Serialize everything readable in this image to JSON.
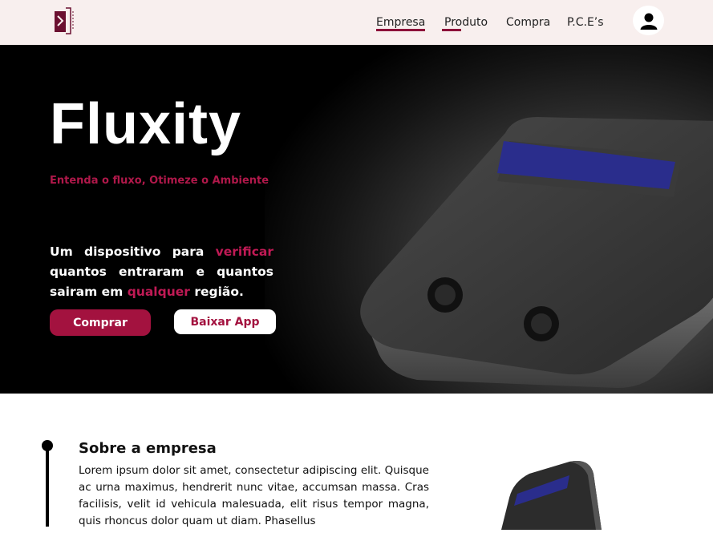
{
  "nav": {
    "links": [
      "Empresa",
      "Produto",
      "Compra",
      "P.C.E’s"
    ]
  },
  "hero": {
    "title": "Fluxity",
    "tagline": "Entenda o fluxo, Otimeze o Ambiente",
    "desc_1": "Um dispositivo para ",
    "desc_hl_1": "verificar",
    "desc_2": " quantos entraram e quantos sairam em ",
    "desc_hl_2": "qualquer",
    "desc_3": " região.",
    "buy_label": "Comprar",
    "app_label": "Baixar App"
  },
  "about": {
    "title": "Sobre a empresa",
    "text": "Lorem ipsum dolor sit amet, consectetur adipiscing elit. Quisque ac urna maximus, hendrerit nunc vitae, accumsan massa. Cras facilisis, velit id vehicula malesuada, elit risus tempor magna, quis rhoncus dolor quam ut diam. Phasellus"
  },
  "colors": {
    "accent": "#a3123f",
    "nav_bg": "#f8efee",
    "hero_bg": "#000000"
  }
}
